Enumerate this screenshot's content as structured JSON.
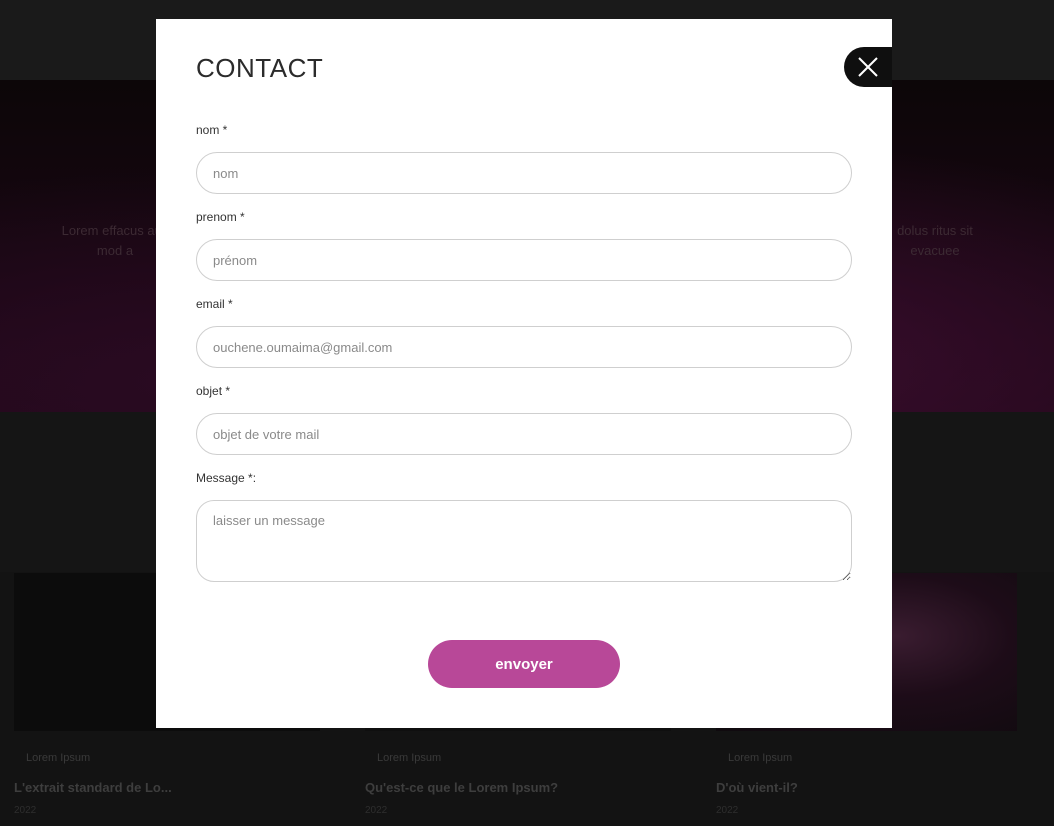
{
  "modal": {
    "title": "CONTACT",
    "close_icon": "close-icon",
    "fields": {
      "nom": {
        "label": "nom *",
        "placeholder": "nom",
        "value": ""
      },
      "prenom": {
        "label": "prenom *",
        "placeholder": "prénom",
        "value": ""
      },
      "email": {
        "label": "email *",
        "placeholder": "ouchene.oumaima@gmail.com",
        "value": ""
      },
      "objet": {
        "label": "objet *",
        "placeholder": "objet de votre mail",
        "value": ""
      },
      "message": {
        "label": "Message *:",
        "placeholder": "laisser un message",
        "value": ""
      }
    },
    "submit_label": "envoyer"
  },
  "background": {
    "hero_left_text": "Lorem effacus aus mod a",
    "hero_right_text": "dolus ritus sit evacuee",
    "cards": [
      {
        "category": "Lorem Ipsum",
        "title": "L'extrait standard de Lo...",
        "meta": "2022"
      },
      {
        "category": "Lorem Ipsum",
        "title": "Qu'est-ce que le Lorem Ipsum?",
        "meta": "2022"
      },
      {
        "category": "Lorem Ipsum",
        "title": "D'où vient-il?",
        "meta": "2022"
      }
    ]
  },
  "colors": {
    "accent": "#b84898",
    "overlay": "#131313",
    "modal_bg": "#ffffff"
  }
}
